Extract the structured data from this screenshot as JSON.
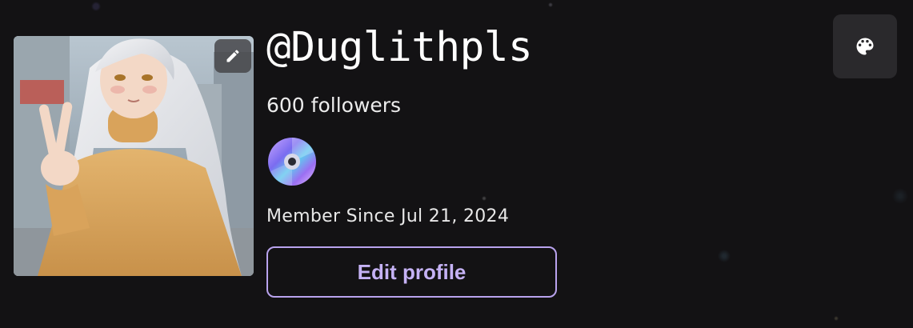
{
  "profile": {
    "username": "@Duglithpls",
    "followers_text": "600 followers",
    "member_since": "Member Since Jul 21, 2024"
  },
  "avatar": {
    "alt": "profile avatar illustration",
    "edit_icon": "pencil-icon"
  },
  "badges": [
    {
      "icon": "disc-icon"
    }
  ],
  "actions": {
    "edit_profile_label": "Edit profile",
    "theme_icon": "palette-icon"
  },
  "colors": {
    "background": "#131214",
    "accent": "#b9a3ee",
    "accent_text": "#c5b2f5",
    "surface": "#2a292c"
  }
}
